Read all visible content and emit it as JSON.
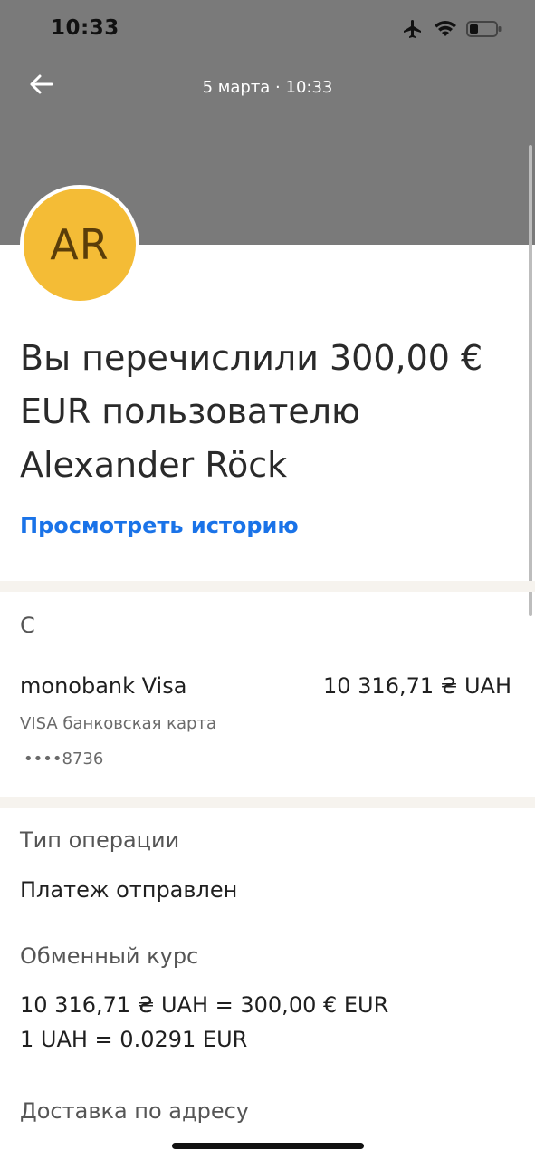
{
  "status_bar": {
    "time": "10:33",
    "icons": [
      "airplane-icon",
      "wifi-icon",
      "battery-icon"
    ]
  },
  "header": {
    "date": "5 марта · 10:33",
    "back_icon": "arrow-left-icon"
  },
  "avatar": {
    "initials": "AR",
    "color": "#f4bc36"
  },
  "transfer": {
    "headline": "Вы перечислили 300,00 € EUR пользователю Alexander Röck",
    "history_link": "Просмотреть историю"
  },
  "source": {
    "label": "С",
    "card_name": "monobank Visa",
    "amount": "10 316,71 ₴ UAH",
    "card_type": "VISA банковская карта",
    "card_mask": "••••8736"
  },
  "details": {
    "operation_type_label": "Тип операции",
    "operation_type_value": "Платеж отправлен",
    "exchange_rate_label": "Обменный курс",
    "exchange_rate_line1": "10 316,71 ₴ UAH = 300,00 € EUR",
    "exchange_rate_line2": "1 UAH = 0.0291 EUR",
    "delivery_label": "Доставка по адресу"
  },
  "colors": {
    "header_bg": "#7a7a7a",
    "link": "#1a73e8",
    "divider": "#f6f3ee"
  }
}
